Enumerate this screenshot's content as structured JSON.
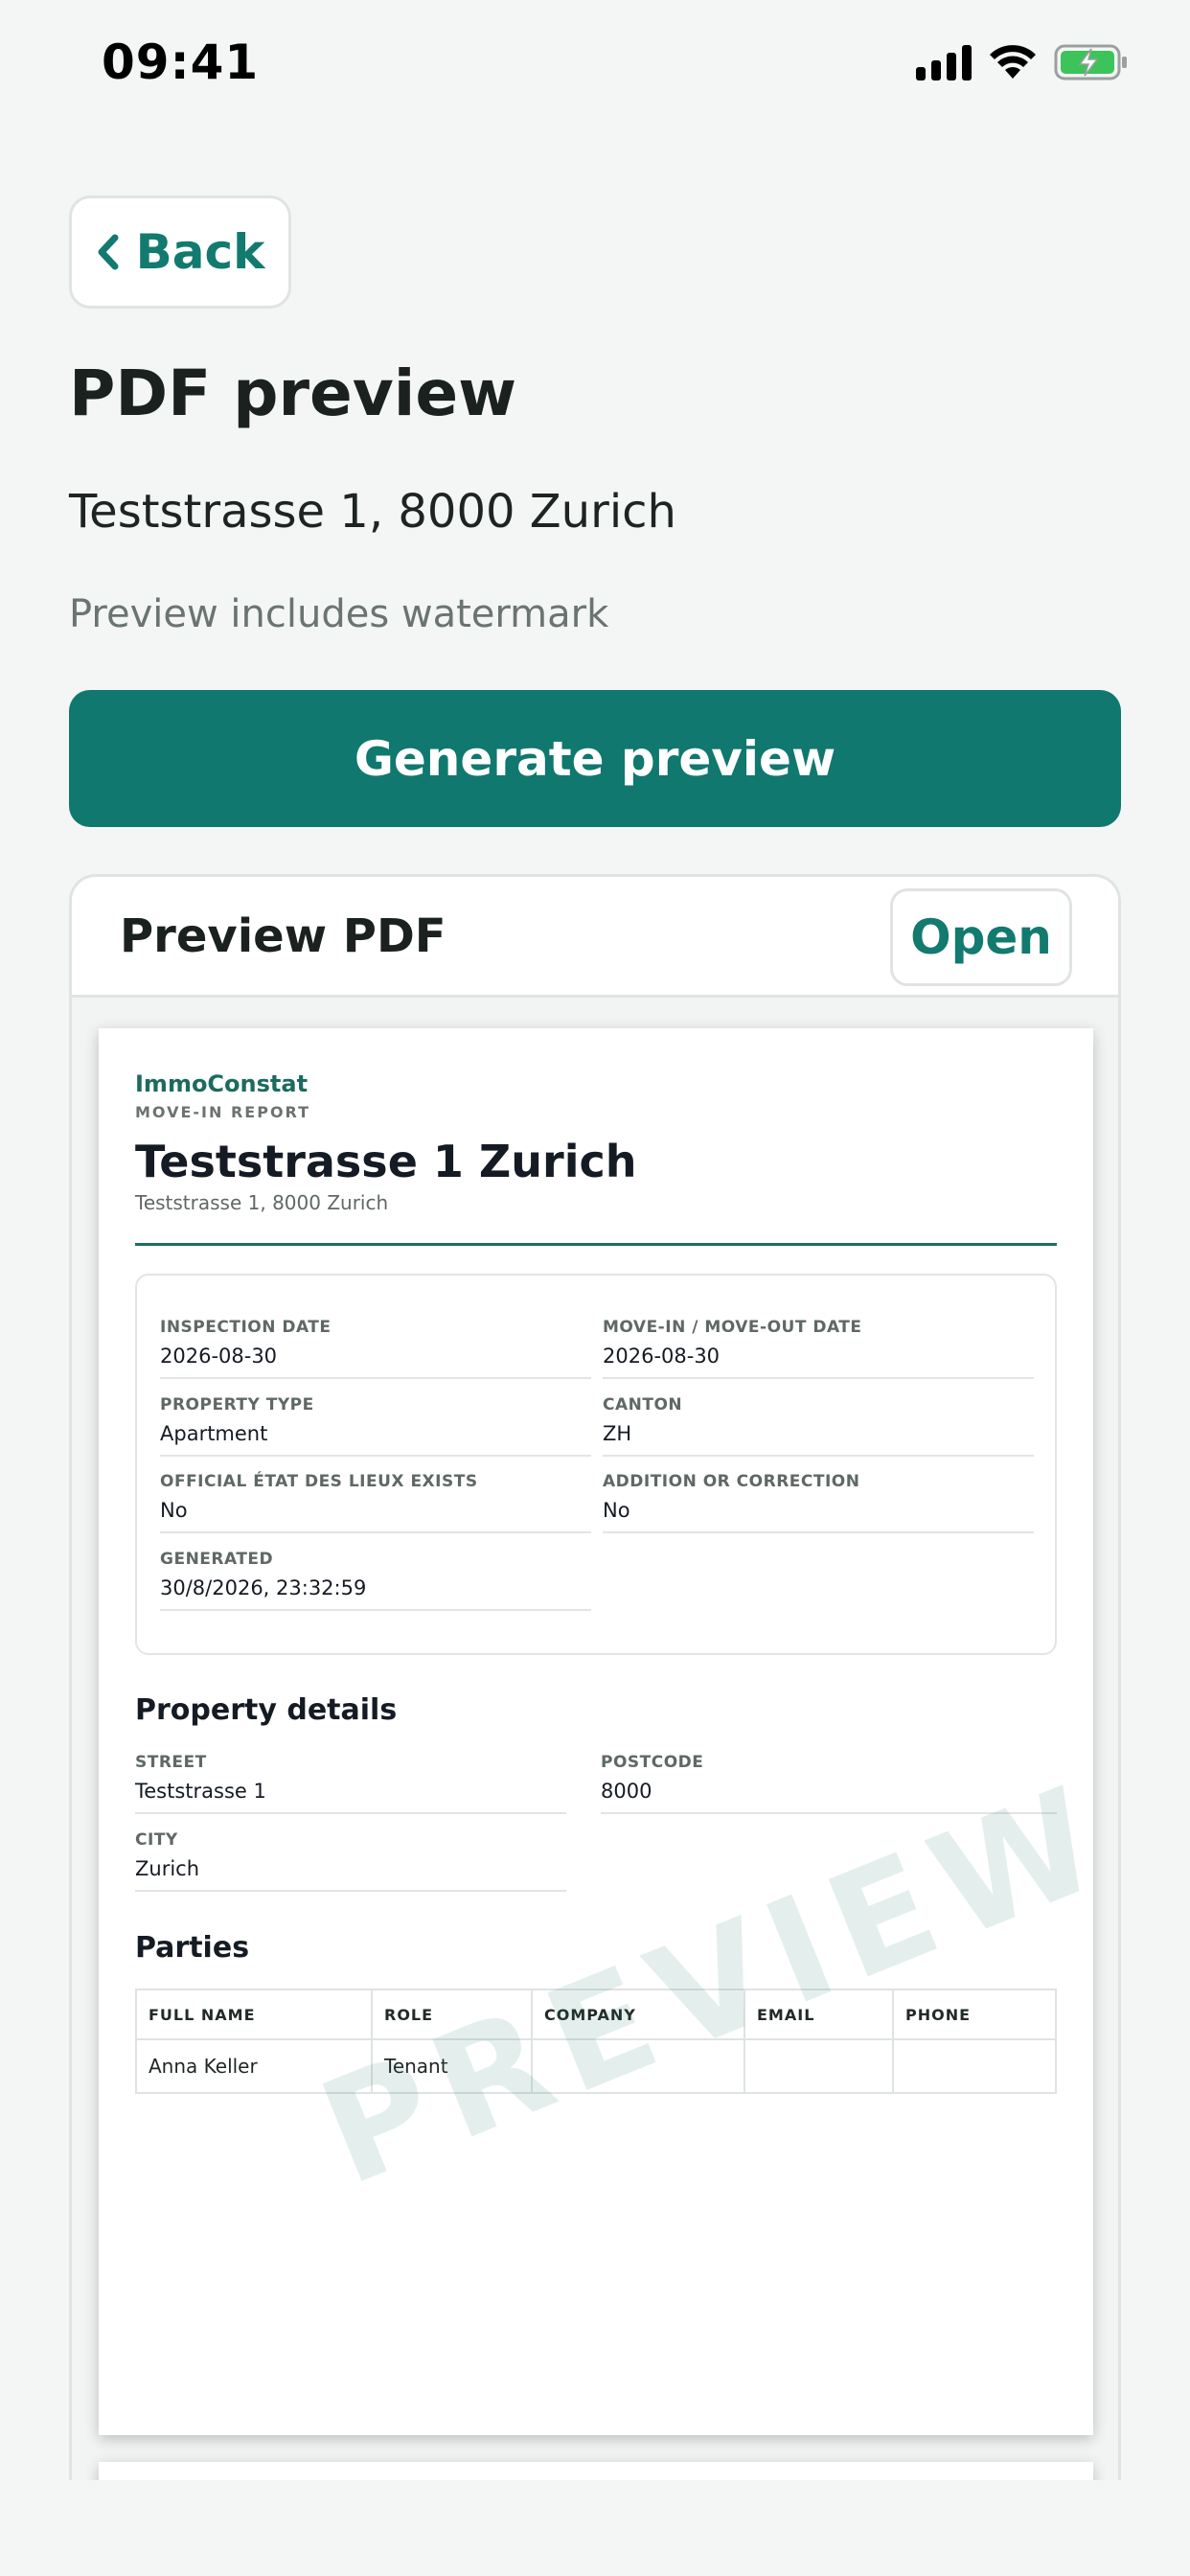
{
  "status_bar": {
    "time": "09:41"
  },
  "header": {
    "back_label": "Back",
    "title": "PDF preview",
    "address": "Teststrasse 1, 8000 Zurich",
    "hint": "Preview includes watermark",
    "generate_label": "Generate preview"
  },
  "preview_card": {
    "title": "Preview PDF",
    "open_label": "Open"
  },
  "pdf": {
    "brand": "ImmoConstat",
    "report_type": "MOVE-IN REPORT",
    "title": "Teststrasse 1 Zurich",
    "subtitle": "Teststrasse 1, 8000 Zurich",
    "meta": [
      {
        "label": "INSPECTION DATE",
        "value": "2026-08-30"
      },
      {
        "label": "MOVE-IN / MOVE-OUT DATE",
        "value": "2026-08-30"
      },
      {
        "label": "PROPERTY TYPE",
        "value": "Apartment"
      },
      {
        "label": "CANTON",
        "value": "ZH"
      },
      {
        "label": "OFFICIAL ÉTAT DES LIEUX EXISTS",
        "value": "No"
      },
      {
        "label": "ADDITION OR CORRECTION",
        "value": "No"
      },
      {
        "label": "GENERATED",
        "value": "30/8/2026, 23:32:59"
      }
    ],
    "property_details": {
      "title": "Property details",
      "fields": [
        {
          "label": "STREET",
          "value": "Teststrasse 1"
        },
        {
          "label": "POSTCODE",
          "value": "8000"
        },
        {
          "label": "CITY",
          "value": "Zurich"
        }
      ]
    },
    "parties": {
      "title": "Parties",
      "columns": [
        "FULL NAME",
        "ROLE",
        "COMPANY",
        "EMAIL",
        "PHONE"
      ],
      "rows": [
        [
          "Anna Keller",
          "Tenant",
          "",
          "",
          ""
        ]
      ]
    },
    "watermark": "PREVIEW"
  },
  "colors": {
    "accent": "#10786e",
    "background": "#f4f6f5",
    "brand_text": "#1c6b5f"
  }
}
